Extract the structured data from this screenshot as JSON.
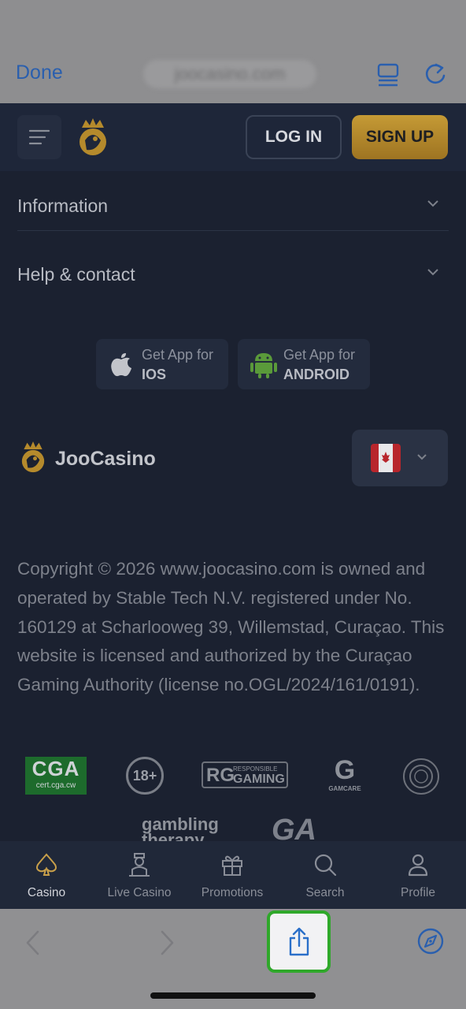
{
  "browser": {
    "done_label": "Done",
    "url": "joocasino.com"
  },
  "header": {
    "login_label": "LOG IN",
    "signup_label": "SIGN UP"
  },
  "accordion": [
    {
      "label": "Information"
    },
    {
      "label": "Help & contact"
    }
  ],
  "apps": {
    "ios": {
      "line1": "Get App for",
      "line2": "IOS"
    },
    "android": {
      "line1": "Get App for",
      "line2": "ANDROID"
    }
  },
  "brand": {
    "name": "JooCasino",
    "language_flag": "Canada"
  },
  "copyright": "Copyright © 2026 www.joocasino.com is owned and operated by Stable Tech N.V. registered under No. 160129 at Scharlooweg 39, Willemstad, Curaçao. This website is licensed and authorized by the Curaçao Gaming Authority (license no.OGL/2024/161/0191).",
  "badges": {
    "cga_big": "CGA",
    "cga_small": "cert.cga.cw",
    "age": "18+",
    "rg_logo": "RG",
    "rg_small": "RESPONSIBLE",
    "rg_big": "GAMING",
    "gamcare_logo": "G",
    "gamcare": "GAMCARE",
    "gambling_therapy": "gambling therapy",
    "ga": "GA"
  },
  "bottom_nav": [
    {
      "label": "Casino",
      "icon": "spade-icon",
      "active": true
    },
    {
      "label": "Live Casino",
      "icon": "dealer-icon",
      "active": false
    },
    {
      "label": "Promotions",
      "icon": "gift-icon",
      "active": false
    },
    {
      "label": "Search",
      "icon": "search-icon",
      "active": false
    },
    {
      "label": "Profile",
      "icon": "profile-icon",
      "active": false
    }
  ],
  "colors": {
    "accent_gold": "#c9a04a",
    "safari_blue": "#2a5fae",
    "highlight_green": "#2fa82a"
  }
}
